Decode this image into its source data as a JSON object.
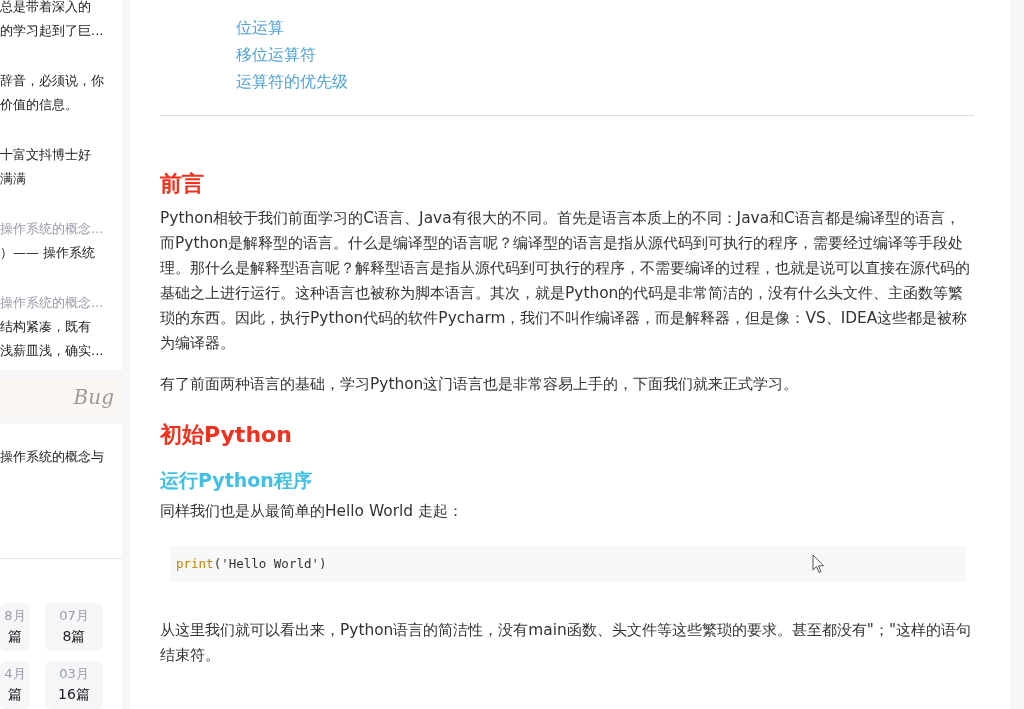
{
  "sidebar": {
    "entries": [
      {
        "kind": "text",
        "lines": [
          "总是带着深入的",
          "的学习起到了巨..."
        ]
      },
      {
        "kind": "text",
        "lines": [
          "辞音，必须说，你",
          "价值的信息。"
        ]
      },
      {
        "kind": "text",
        "lines": [
          "十富文抖博士好",
          "满满"
        ]
      },
      {
        "kind": "related",
        "lines": [
          "操作系统的概念...",
          "）—— 操作系统"
        ]
      },
      {
        "kind": "related",
        "lines": [
          "操作系统的概念...",
          "结构紧凑，既有",
          "浅薪皿浅，确实..."
        ]
      }
    ],
    "banner": {
      "text": "Bug"
    },
    "recommend": {
      "lines": [
        "操作系统的概念与"
      ]
    },
    "archive": [
      {
        "month": "8月",
        "count": "篇"
      },
      {
        "month": "07月",
        "count": "8篇"
      },
      {
        "month": "4月",
        "count": "篇"
      },
      {
        "month": "03月",
        "count": "16篇"
      }
    ]
  },
  "toc": [
    "位运算",
    "移位运算符",
    "运算符的优先级"
  ],
  "article": [
    {
      "kind": "h1",
      "text": "前言"
    },
    {
      "kind": "p",
      "text": "Python相较于我们前面学习的C语言、Java有很大的不同。首先是语言本质上的不同：Java和C语言都是编译型的语言，而Python是解释型的语言。什么是编译型的语言呢？编译型的语言是指从源代码到可执行的程序，需要经过编译等手段处理。那什么是解释型语言呢？解释型语言是指从源代码到可执行的程序，不需要编译的过程，也就是说可以直接在源代码的基础之上进行运行。这种语言也被称为脚本语言。其次，就是Python的代码是非常简洁的，没有什么头文件、主函数等繁琐的东西。因此，执行Python代码的软件Pycharm，我们不叫作编译器，而是解释器，但是像：VS、IDEA这些都是被称为编译器。"
    },
    {
      "kind": "p",
      "text": "有了前面两种语言的基础，学习Python这门语言也是非常容易上手的，下面我们就来正式学习。"
    },
    {
      "kind": "h1",
      "text": "初始Python"
    },
    {
      "kind": "h2",
      "text": "运行Python程序"
    },
    {
      "kind": "p",
      "text": "同样我们也是从最简单的Hello World 走起："
    },
    {
      "kind": "code",
      "fn": "print",
      "arg": "('Hello World')"
    },
    {
      "kind": "p",
      "text": "从这里我们就可以看出来，Python语言的简洁性，没有main函数、头文件等这些繁琐的要求。甚至都没有\"；\"这样的语句结束符。"
    }
  ]
}
